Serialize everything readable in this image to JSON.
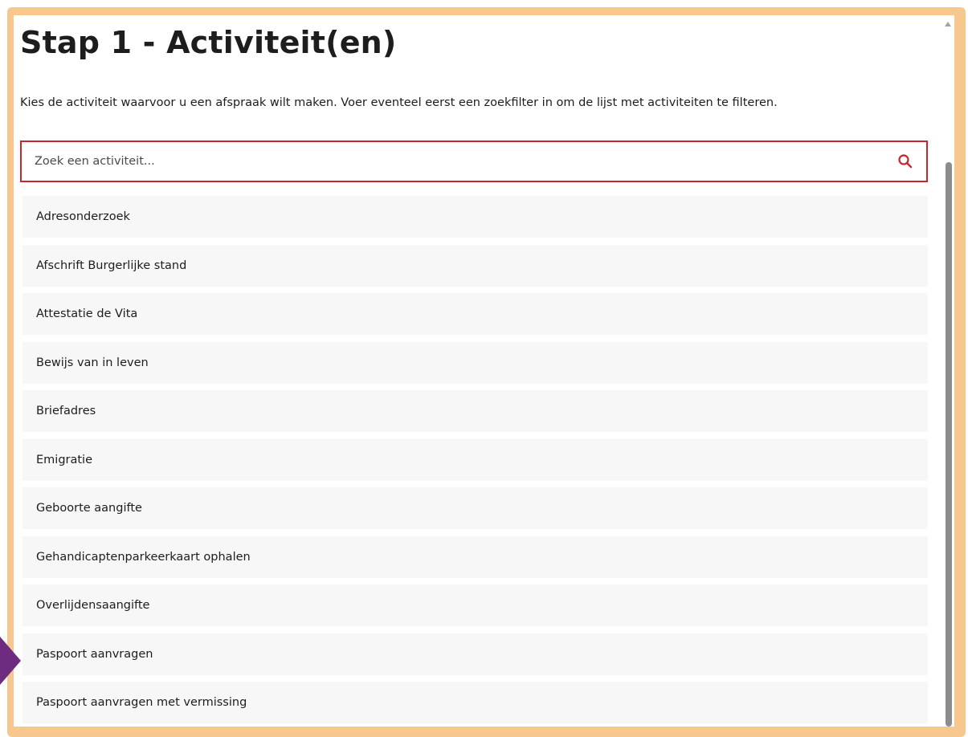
{
  "header": {
    "title": "Stap 1 - Activiteit(en)",
    "intro": "Kies de activiteit waarvoor u een afspraak wilt maken. Voer eventeel eerst een zoekfilter in om de lijst met activiteiten te filteren."
  },
  "search": {
    "placeholder": "Zoek een activiteit...",
    "value": "",
    "icon": "search-icon"
  },
  "activities": [
    "Adresonderzoek",
    "Afschrift Burgerlijke stand",
    "Attestatie de Vita",
    "Bewijs van in leven",
    "Briefadres",
    "Emigratie",
    "Geboorte aangifte",
    "Gehandicaptenparkeerkaart ophalen",
    "Overlijdensaangifte",
    "Paspoort aanvragen",
    "Paspoort aanvragen met vermissing"
  ],
  "colors": {
    "frame": "#f6c88f",
    "accent": "#c8252c",
    "marker": "#6d2c80",
    "item_bg": "#f7f7f7"
  }
}
